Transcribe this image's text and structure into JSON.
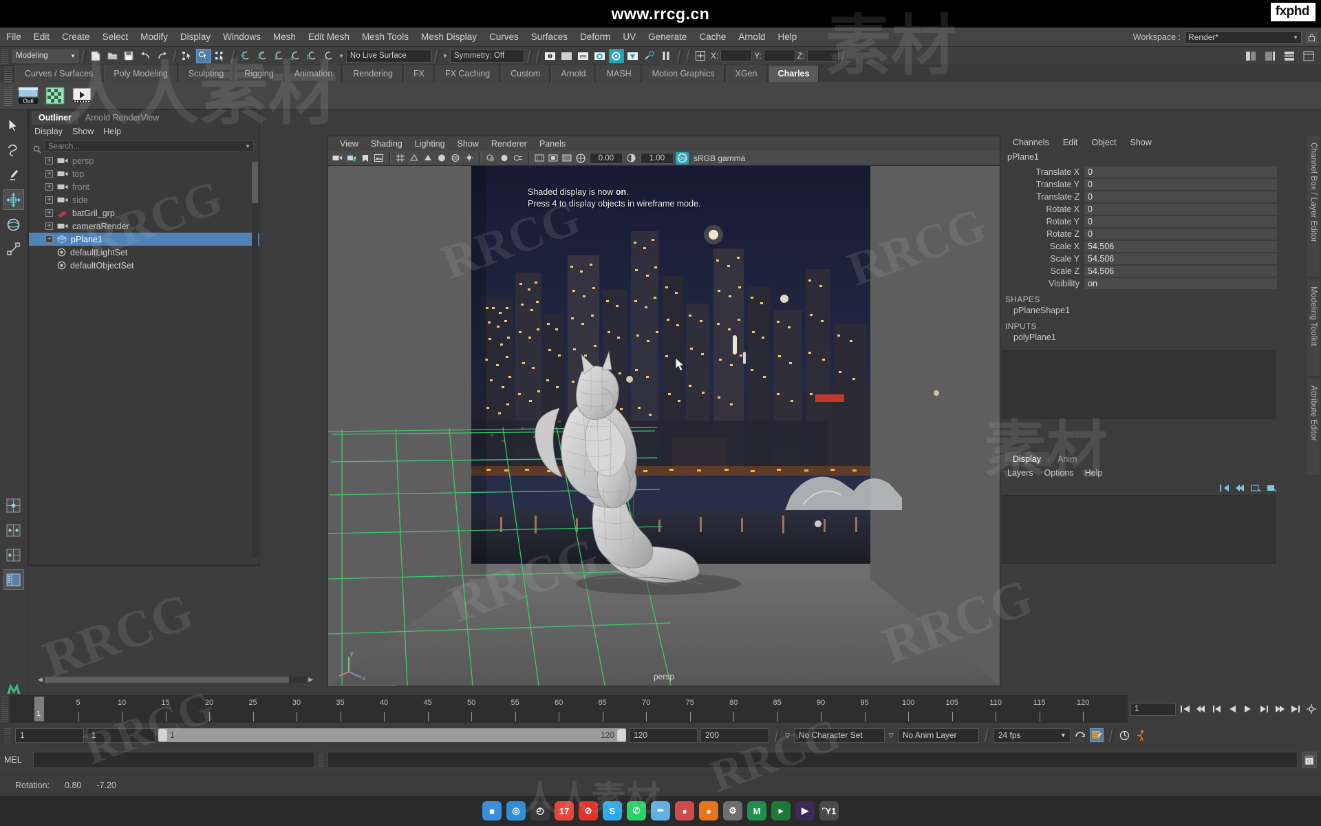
{
  "banner": {
    "url": "www.rrcg.cn",
    "logo": "fxphd"
  },
  "menubar": {
    "items": [
      "File",
      "Edit",
      "Create",
      "Select",
      "Modify",
      "Display",
      "Windows",
      "Mesh",
      "Edit Mesh",
      "Mesh Tools",
      "Mesh Display",
      "Curves",
      "Surfaces",
      "Deform",
      "UV",
      "Generate",
      "Cache",
      "Arnold",
      "Help"
    ],
    "workspace_label": "Workspace :",
    "workspace_value": "Render*"
  },
  "statusbar": {
    "menuset": "Modeling",
    "live_surface": "No Live Surface",
    "symmetry": "Symmetry: Off",
    "coord_x": "X:",
    "coord_y": "Y:",
    "coord_z": "Z:",
    "coord_x_value": "",
    "coord_y_value": "",
    "coord_z_value": ""
  },
  "shelf": {
    "tabs": [
      "Curves / Surfaces",
      "Poly Modeling",
      "Sculpting",
      "Rigging",
      "Animation",
      "Rendering",
      "FX",
      "FX Caching",
      "Custom",
      "Arnold",
      "MASH",
      "Motion Graphics",
      "XGen",
      "Charles"
    ],
    "active_tab": "Charles"
  },
  "outliner": {
    "tabs": [
      "Outliner",
      "Arnold RenderView"
    ],
    "active_tab": "Outliner",
    "menu": [
      "Display",
      "Show",
      "Help"
    ],
    "search_placeholder": "Search...",
    "items": [
      {
        "label": "persp",
        "icon": "camera-icon",
        "dim": true,
        "selected": false
      },
      {
        "label": "top",
        "icon": "camera-icon",
        "dim": true,
        "selected": false
      },
      {
        "label": "front",
        "icon": "camera-icon",
        "dim": true,
        "selected": false
      },
      {
        "label": "side",
        "icon": "camera-icon",
        "dim": true,
        "selected": false
      },
      {
        "label": "batGril_grp",
        "icon": "group-icon",
        "dim": false,
        "selected": false
      },
      {
        "label": "cameraRender",
        "icon": "camera-icon",
        "dim": false,
        "selected": false
      },
      {
        "label": "pPlane1",
        "icon": "mesh-icon",
        "dim": false,
        "selected": true
      },
      {
        "label": "defaultLightSet",
        "icon": "set-icon",
        "dim": false,
        "selected": false
      },
      {
        "label": "defaultObjectSet",
        "icon": "set-icon",
        "dim": false,
        "selected": false
      }
    ]
  },
  "shelf_toolbar_label": "Outl",
  "viewport": {
    "menu": [
      "View",
      "Shading",
      "Lighting",
      "Show",
      "Renderer",
      "Panels"
    ],
    "exposure_value": "0.00",
    "gamma_value": "1.00",
    "color_mgmt_toggle": "ON",
    "color_space": "sRGB gamma",
    "camera_label": "persp",
    "tip_line1_a": "Shaded display is now ",
    "tip_line1_b": "on",
    "tip_line1_c": ".",
    "tip_line2": "Press 4 to display objects in wireframe mode."
  },
  "channelbox": {
    "menu": [
      "Channels",
      "Edit",
      "Object",
      "Show"
    ],
    "node_name": "pPlane1",
    "attributes": [
      {
        "label": "Translate X",
        "value": "0"
      },
      {
        "label": "Translate Y",
        "value": "0"
      },
      {
        "label": "Translate Z",
        "value": "0"
      },
      {
        "label": "Rotate X",
        "value": "0"
      },
      {
        "label": "Rotate Y",
        "value": "0"
      },
      {
        "label": "Rotate Z",
        "value": "0"
      },
      {
        "label": "Scale X",
        "value": "54.506"
      },
      {
        "label": "Scale Y",
        "value": "54.506"
      },
      {
        "label": "Scale Z",
        "value": "54.506"
      },
      {
        "label": "Visibility",
        "value": "on"
      }
    ],
    "shapes_header": "SHAPES",
    "shapes_item": "pPlaneShape1",
    "inputs_header": "INPUTS",
    "inputs_item": "polyPlane1"
  },
  "layer_editor": {
    "tabs": [
      "Display",
      "Anim"
    ],
    "active_tab": "Display",
    "menu": [
      "Layers",
      "Options",
      "Help"
    ]
  },
  "right_tabs": [
    "Channel Box / Layer Editor",
    "Modeling Toolkit",
    "Attribute Editor"
  ],
  "timeline": {
    "current_frame": "1",
    "ticks": [
      5,
      10,
      15,
      20,
      25,
      30,
      35,
      40,
      45,
      50,
      55,
      60,
      65,
      70,
      75,
      80,
      85,
      90,
      95,
      100,
      105,
      110,
      115,
      120
    ],
    "frame_field": "1"
  },
  "range": {
    "start_field": "1",
    "by_field": "1",
    "range_start": "1",
    "range_end": "120",
    "anim_end": "120",
    "playback_end": "200",
    "character_set": "No Character Set",
    "anim_layer": "No Anim Layer",
    "fps": "24 fps"
  },
  "mel": {
    "label": "MEL",
    "input_value": "",
    "output_value": ""
  },
  "helpline": {
    "rotation_label": "Rotation:",
    "rot_a": "0.80",
    "rot_b": "-7.20"
  },
  "dock": {
    "apps": [
      {
        "name": "finder-icon",
        "color": "#3b8ed8",
        "glyph": "■"
      },
      {
        "name": "safari-icon",
        "color": "#2f8fd6",
        "glyph": "◎"
      },
      {
        "name": "clock-icon",
        "color": "#3a3a3a",
        "glyph": "◴"
      },
      {
        "name": "calendar-icon",
        "color": "#e8453c",
        "glyph": "17"
      },
      {
        "name": "block-icon",
        "color": "#e0312a",
        "glyph": "⊘"
      },
      {
        "name": "skype-icon",
        "color": "#29a9ea",
        "glyph": "S"
      },
      {
        "name": "whatsapp-icon",
        "color": "#25d366",
        "glyph": "✆"
      },
      {
        "name": "tweetbot-icon",
        "color": "#5fb0e5",
        "glyph": "✒"
      },
      {
        "name": "colors-icon",
        "color": "#cf4a4a",
        "glyph": "●"
      },
      {
        "name": "firefox-icon",
        "color": "#e8741b",
        "glyph": "●"
      },
      {
        "name": "preferences-icon",
        "color": "#6e6e6e",
        "glyph": "⚙"
      },
      {
        "name": "maya-icon",
        "color": "#1f8f4d",
        "glyph": "M"
      },
      {
        "name": "terminal-icon",
        "color": "#1b7a36",
        "glyph": "▸"
      },
      {
        "name": "premiere-icon",
        "color": "#3a2a55",
        "glyph": "▶"
      },
      {
        "name": "trash-icon",
        "color": "#4a4a4a",
        "glyph": "Ὕ1"
      }
    ]
  },
  "colors": {
    "accent_blue": "#4f82b8",
    "accent_teal": "#2aa0b4",
    "panel_bg": "#3c3c3c",
    "grid_green": "#3ecf6e"
  }
}
